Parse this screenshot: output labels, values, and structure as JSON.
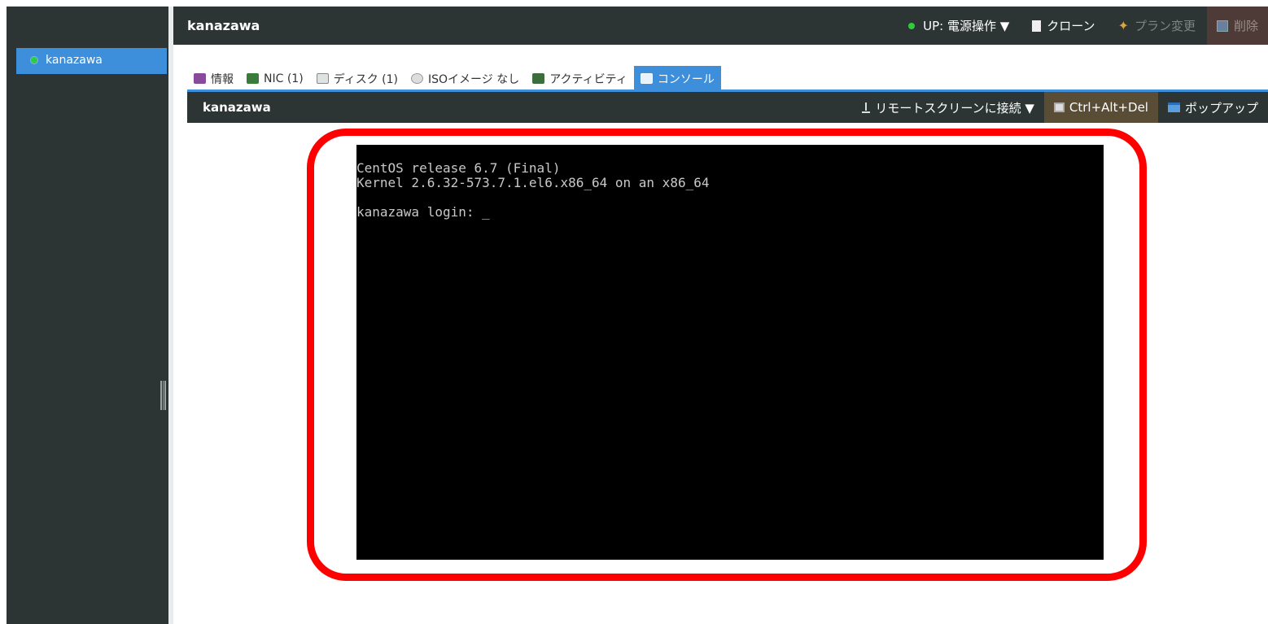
{
  "header": {
    "title": "kanazawa",
    "power_status": "UP: 電源操作 ▼",
    "clone": "クローン",
    "plan_change": "プラン変更",
    "delete": "削除"
  },
  "sidebar": {
    "items": [
      {
        "label": "kanazawa",
        "status": "running"
      }
    ]
  },
  "tabs": [
    {
      "label": "情報"
    },
    {
      "label": "NIC (1)"
    },
    {
      "label": "ディスク (1)"
    },
    {
      "label": "ISOイメージ なし"
    },
    {
      "label": "アクティビティ"
    },
    {
      "label": "コンソール",
      "active": true
    }
  ],
  "console": {
    "title": "kanazawa",
    "remote_screen": "リモートスクリーンに接続 ▼",
    "ctrl_alt_del": "Ctrl+Alt+Del",
    "popup": "ポップアップ",
    "lines": [
      "CentOS release 6.7 (Final)",
      "Kernel 2.6.32-573.7.1.el6.x86_64 on an x86_64",
      "",
      "kanazawa login: _"
    ]
  },
  "colors": {
    "dark_bar": "#2c3533",
    "accent_blue": "#3d8fdb",
    "highlight_red": "#ff0000",
    "status_green": "#2ecc40"
  }
}
